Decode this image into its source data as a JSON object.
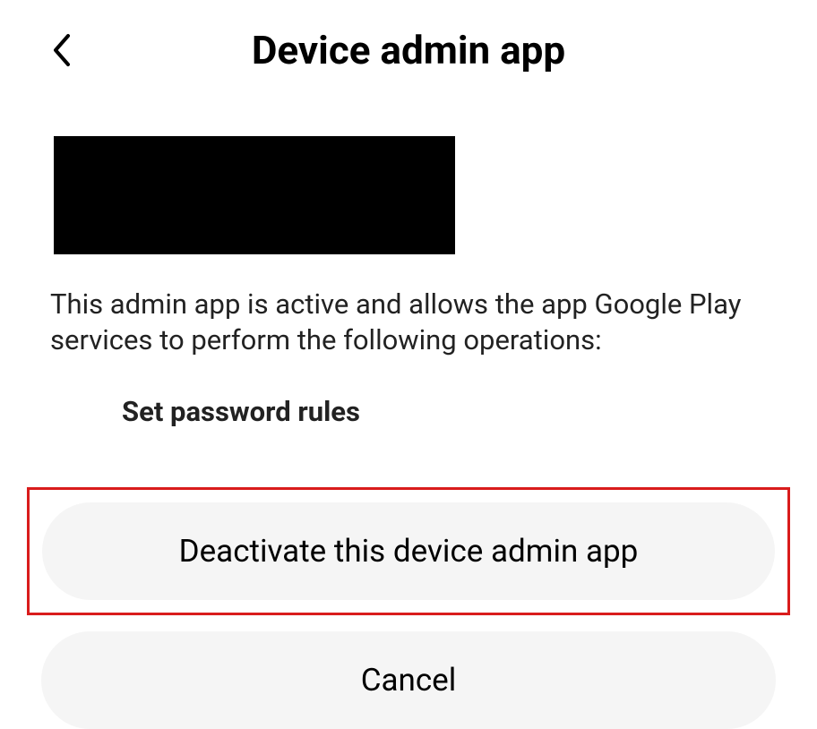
{
  "header": {
    "title": "Device admin app"
  },
  "description": "This admin app is active and allows the app Google Play services to perform the following operations:",
  "operations": {
    "item1": "Set password rules"
  },
  "buttons": {
    "deactivate": "Deactivate this device admin app",
    "cancel": "Cancel"
  }
}
